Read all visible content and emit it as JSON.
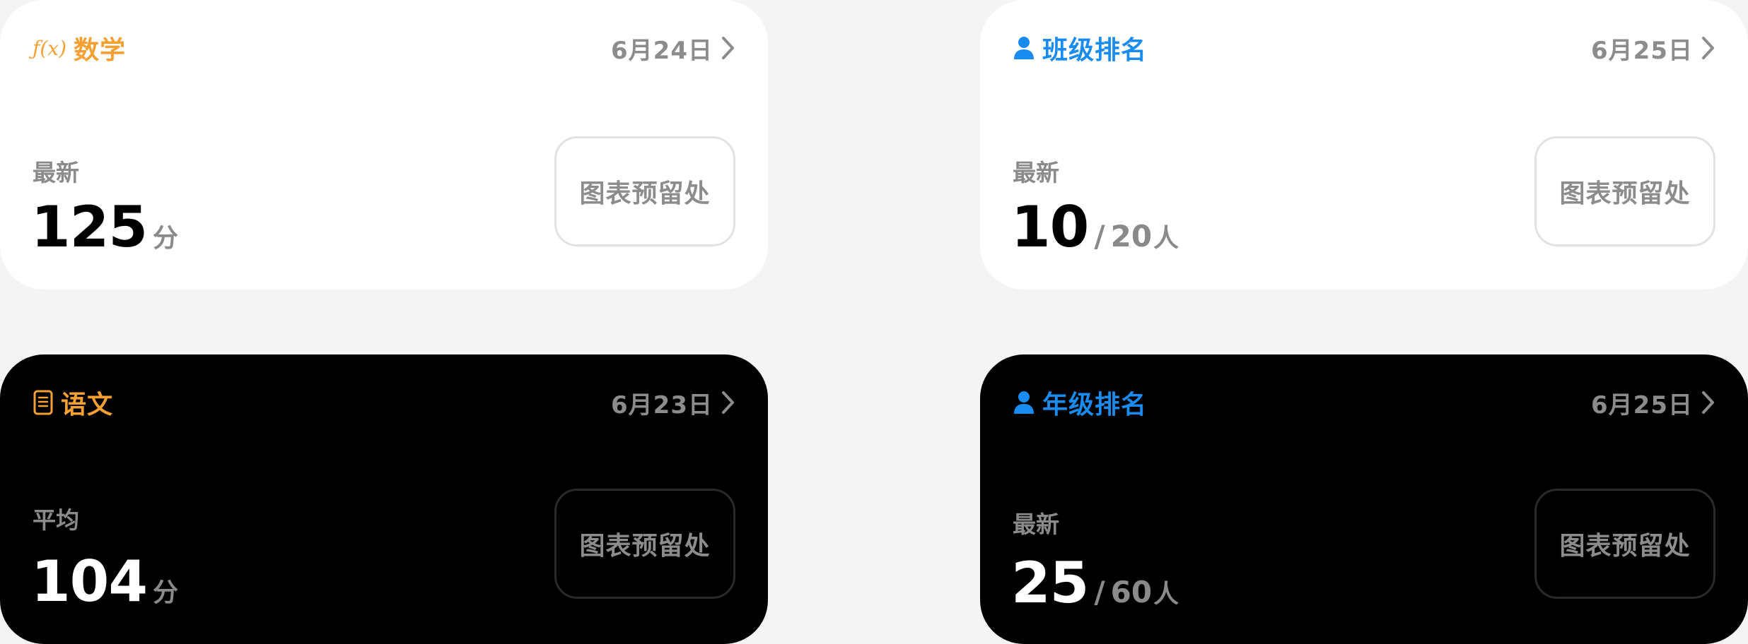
{
  "cards": [
    {
      "title": "数学",
      "icon": "function-icon",
      "accent": "#f5a033",
      "date": "6月24日",
      "metric_label": "最新",
      "value": "125",
      "suffix": "分",
      "chart_placeholder": "图表预留处"
    },
    {
      "title": "班级排名",
      "icon": "person-icon",
      "accent": "#1a8cf0",
      "date": "6月25日",
      "metric_label": "最新",
      "value": "10",
      "separator": "/",
      "total": "20",
      "suffix": "人",
      "chart_placeholder": "图表预留处"
    },
    {
      "title": "语文",
      "icon": "document-icon",
      "accent": "#f5a033",
      "date": "6月23日",
      "metric_label": "平均",
      "value": "104",
      "suffix": "分",
      "chart_placeholder": "图表预留处"
    },
    {
      "title": "年级排名",
      "icon": "person-icon",
      "accent": "#1a8cf0",
      "date": "6月25日",
      "metric_label": "最新",
      "value": "25",
      "separator": "/",
      "total": "60",
      "suffix": "人",
      "chart_placeholder": "图表预留处"
    }
  ],
  "icons": {
    "function_glyph": "ƒ(x)"
  }
}
